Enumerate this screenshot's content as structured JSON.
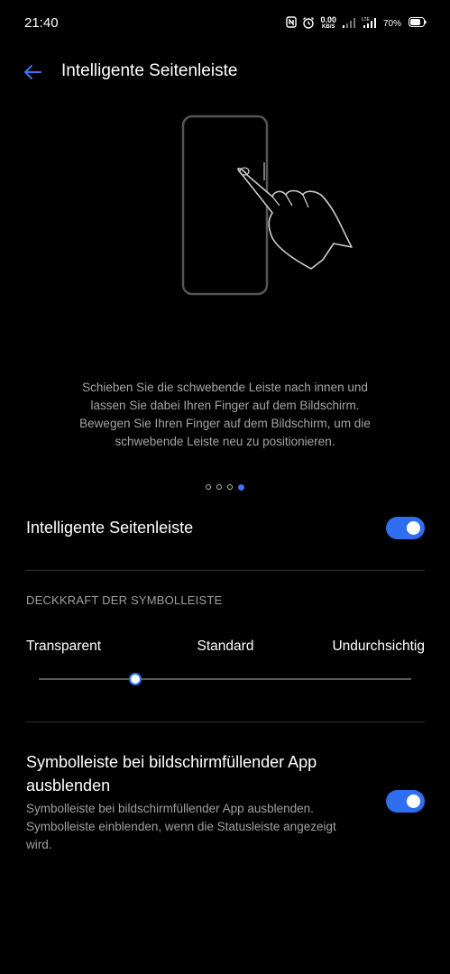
{
  "status_bar": {
    "time": "21:40",
    "net_speed_value": "0.00",
    "net_speed_unit": "KB/S",
    "battery_percent": "70%",
    "icons": [
      "nfc-icon",
      "alarm-icon",
      "signal-icon",
      "lte-signal-icon",
      "battery-icon"
    ]
  },
  "header": {
    "title": "Intelligente Seitenleiste",
    "back_icon": "arrow-left-icon"
  },
  "illustration": {
    "description": "Schieben Sie die schwebende Leiste nach innen und lassen Sie dabei Ihren Finger auf dem Bildschirm. Bewegen Sie Ihren Finger auf dem Bildschirm, um die schwebende Leiste neu zu positionieren.",
    "pager_count": 4,
    "pager_active_index": 3
  },
  "main_toggle": {
    "label": "Intelligente Seitenleiste",
    "enabled": true
  },
  "opacity": {
    "section_header": "DECKKRAFT DER SYMBOLLEISTE",
    "labels": [
      "Transparent",
      "Standard",
      "Undurchsichtig"
    ],
    "value": 0.26
  },
  "hide_toggle": {
    "title": "Symbolleiste bei bildschirmfüllender App ausblenden",
    "description": "Symbolleiste bei bildschirmfüllender App ausblenden. Symbolleiste einblenden, wenn die Statusleiste angezeigt wird.",
    "enabled": true
  },
  "colors": {
    "accent": "#2f6ef0",
    "background": "#000000",
    "secondary_text": "#a4a4a4"
  }
}
